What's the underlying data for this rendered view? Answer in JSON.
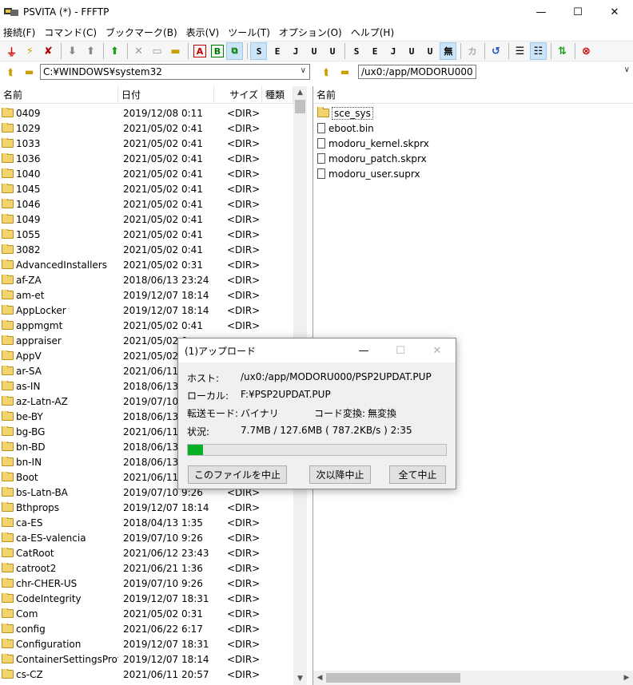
{
  "window": {
    "title": "PSVITA (*) - FFFTP",
    "min": "—",
    "max": "☐",
    "close": "✕"
  },
  "menu": [
    "接続(F)",
    "コマンド(C)",
    "ブックマーク(B)",
    "表示(V)",
    "ツール(T)",
    "オプション(O)",
    "ヘルプ(H)"
  ],
  "toolbar": {
    "text_buttons": {
      "sjis1": "S",
      "euc1": "E",
      "jis1": "J",
      "utf8n1": "U",
      "utf8b1": "U",
      "sjis2": "S",
      "euc2": "E",
      "jis2": "J",
      "utf8n2": "U",
      "utf8b2": "U",
      "none": "無",
      "kana": "カ"
    }
  },
  "local": {
    "path": "C:¥WINDOWS¥system32",
    "columns": {
      "name": "名前",
      "date": "日付",
      "size": "サイズ",
      "kind": "種類"
    },
    "files": [
      {
        "name": "0409",
        "date": "2019/12/08  0:11",
        "size": "<DIR>"
      },
      {
        "name": "1029",
        "date": "2021/05/02  0:41",
        "size": "<DIR>"
      },
      {
        "name": "1033",
        "date": "2021/05/02  0:41",
        "size": "<DIR>"
      },
      {
        "name": "1036",
        "date": "2021/05/02  0:41",
        "size": "<DIR>"
      },
      {
        "name": "1040",
        "date": "2021/05/02  0:41",
        "size": "<DIR>"
      },
      {
        "name": "1045",
        "date": "2021/05/02  0:41",
        "size": "<DIR>"
      },
      {
        "name": "1046",
        "date": "2021/05/02  0:41",
        "size": "<DIR>"
      },
      {
        "name": "1049",
        "date": "2021/05/02  0:41",
        "size": "<DIR>"
      },
      {
        "name": "1055",
        "date": "2021/05/02  0:41",
        "size": "<DIR>"
      },
      {
        "name": "3082",
        "date": "2021/05/02  0:41",
        "size": "<DIR>"
      },
      {
        "name": "AdvancedInstallers",
        "date": "2021/05/02  0:31",
        "size": "<DIR>"
      },
      {
        "name": "af-ZA",
        "date": "2018/06/13 23:24",
        "size": "<DIR>"
      },
      {
        "name": "am-et",
        "date": "2019/12/07 18:14",
        "size": "<DIR>"
      },
      {
        "name": "AppLocker",
        "date": "2019/12/07 18:14",
        "size": "<DIR>"
      },
      {
        "name": "appmgmt",
        "date": "2021/05/02  0:41",
        "size": "<DIR>"
      },
      {
        "name": "appraiser",
        "date": "2021/05/02  0",
        "size": ""
      },
      {
        "name": "AppV",
        "date": "2021/05/02  0",
        "size": ""
      },
      {
        "name": "ar-SA",
        "date": "2021/06/11 2",
        "size": ""
      },
      {
        "name": "as-IN",
        "date": "2018/06/13 2",
        "size": ""
      },
      {
        "name": "az-Latn-AZ",
        "date": "2019/07/10  9",
        "size": ""
      },
      {
        "name": "be-BY",
        "date": "2018/06/13 2",
        "size": ""
      },
      {
        "name": "bg-BG",
        "date": "2021/06/11 2",
        "size": ""
      },
      {
        "name": "bn-BD",
        "date": "2018/06/13 2",
        "size": ""
      },
      {
        "name": "bn-IN",
        "date": "2018/06/13 2",
        "size": ""
      },
      {
        "name": "Boot",
        "date": "2021/06/11 2",
        "size": ""
      },
      {
        "name": "bs-Latn-BA",
        "date": "2019/07/10  9:26",
        "size": "<DIR>"
      },
      {
        "name": "Bthprops",
        "date": "2019/12/07 18:14",
        "size": "<DIR>"
      },
      {
        "name": "ca-ES",
        "date": "2018/04/13  1:35",
        "size": "<DIR>"
      },
      {
        "name": "ca-ES-valencia",
        "date": "2019/07/10  9:26",
        "size": "<DIR>"
      },
      {
        "name": "CatRoot",
        "date": "2021/06/12 23:43",
        "size": "<DIR>"
      },
      {
        "name": "catroot2",
        "date": "2021/06/21  1:36",
        "size": "<DIR>"
      },
      {
        "name": "chr-CHER-US",
        "date": "2019/07/10  9:26",
        "size": "<DIR>"
      },
      {
        "name": "CodeIntegrity",
        "date": "2019/12/07 18:31",
        "size": "<DIR>"
      },
      {
        "name": "Com",
        "date": "2021/05/02  0:31",
        "size": "<DIR>"
      },
      {
        "name": "config",
        "date": "2021/06/22  6:17",
        "size": "<DIR>"
      },
      {
        "name": "Configuration",
        "date": "2019/12/07 18:31",
        "size": "<DIR>"
      },
      {
        "name": "ContainerSettingsProv...",
        "date": "2019/12/07 18:14",
        "size": "<DIR>"
      },
      {
        "name": "cs-CZ",
        "date": "2021/06/11 20:57",
        "size": "<DIR>"
      }
    ]
  },
  "remote": {
    "path": "/ux0:/app/MODORU000",
    "columns": {
      "name": "名前"
    },
    "files": [
      {
        "name": "sce_sys",
        "type": "folder"
      },
      {
        "name": "eboot.bin",
        "type": "file"
      },
      {
        "name": "modoru_kernel.skprx",
        "type": "file"
      },
      {
        "name": "modoru_patch.skprx",
        "type": "file"
      },
      {
        "name": "modoru_user.suprx",
        "type": "file"
      }
    ]
  },
  "dialog": {
    "title": "(1)アップロード",
    "host_label": "ホスト:",
    "host_value": "/ux0:/app/MODORU000/PSP2UPDAT.PUP",
    "local_label": "ローカル:",
    "local_value": "F:¥PSP2UPDAT.PUP",
    "mode_label": "転送モード:",
    "mode_value": "バイナリ",
    "code_label": "コード変換:",
    "code_value": "無変換",
    "status_label": "状況:",
    "status_value": "7.7MB / 127.6MB ( 787.2KB/s )  2:35",
    "progress": 0.06,
    "btn_cancel_file": "このファイルを中止",
    "btn_cancel_next": "次以降中止",
    "btn_cancel_all": "全て中止"
  }
}
